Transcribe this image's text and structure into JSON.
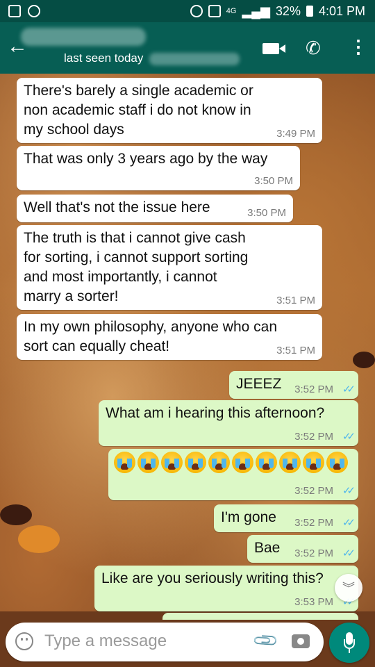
{
  "status_bar": {
    "battery": "32%",
    "network": "4G",
    "time": "4:01 PM"
  },
  "header": {
    "last_seen": "last seen today"
  },
  "messages": [
    {
      "direction": "in",
      "text": "There's barely a single academic or\nnon academic staff i do not know in\nmy school days",
      "time": "3:49 PM"
    },
    {
      "direction": "in",
      "text": "That was only 3 years ago by the way",
      "time": "3:50 PM"
    },
    {
      "direction": "in",
      "text": "Well that's not the issue here",
      "time": "3:50 PM"
    },
    {
      "direction": "in",
      "text": "The truth is that i cannot give cash\nfor sorting, i cannot support sorting\nand most importantly, i cannot\nmarry a sorter!",
      "time": "3:51 PM"
    },
    {
      "direction": "in",
      "text": "In my own philosophy, anyone who can\nsort can equally cheat!",
      "time": "3:51 PM"
    },
    {
      "direction": "out",
      "text": "JEEEZ",
      "time": "3:52 PM",
      "status": "read"
    },
    {
      "direction": "out",
      "text": "What am i hearing this afternoon?",
      "time": "3:52 PM",
      "status": "read"
    },
    {
      "direction": "out",
      "text": "😭😭😭😭😭😭😭😭😭😭",
      "emoji": "loudly-crying-face",
      "emoji_count": 10,
      "time": "3:52 PM",
      "status": "read"
    },
    {
      "direction": "out",
      "text": "I'm gone",
      "time": "3:52 PM",
      "status": "read"
    },
    {
      "direction": "out",
      "text": "Bae",
      "time": "3:52 PM",
      "status": "read"
    },
    {
      "direction": "out",
      "text": "Like are you seriously writing this?",
      "time": "3:53 PM",
      "status": "read"
    }
  ],
  "input": {
    "placeholder": "Type a message"
  },
  "colors": {
    "header": "#075e54",
    "status_bar": "#054d44",
    "outgoing_bubble": "#dcf8c6",
    "incoming_bubble": "#ffffff",
    "read_tick": "#4fb6ec",
    "mic_button": "#00897b"
  },
  "icons": {
    "back": "arrow-left-icon",
    "video": "video-call-icon",
    "call": "phone-icon",
    "menu": "more-vert-icon",
    "emoji": "emoji-icon",
    "attach": "paperclip-icon",
    "camera": "camera-icon",
    "mic": "mic-icon",
    "scroll": "chevron-double-down-icon"
  }
}
